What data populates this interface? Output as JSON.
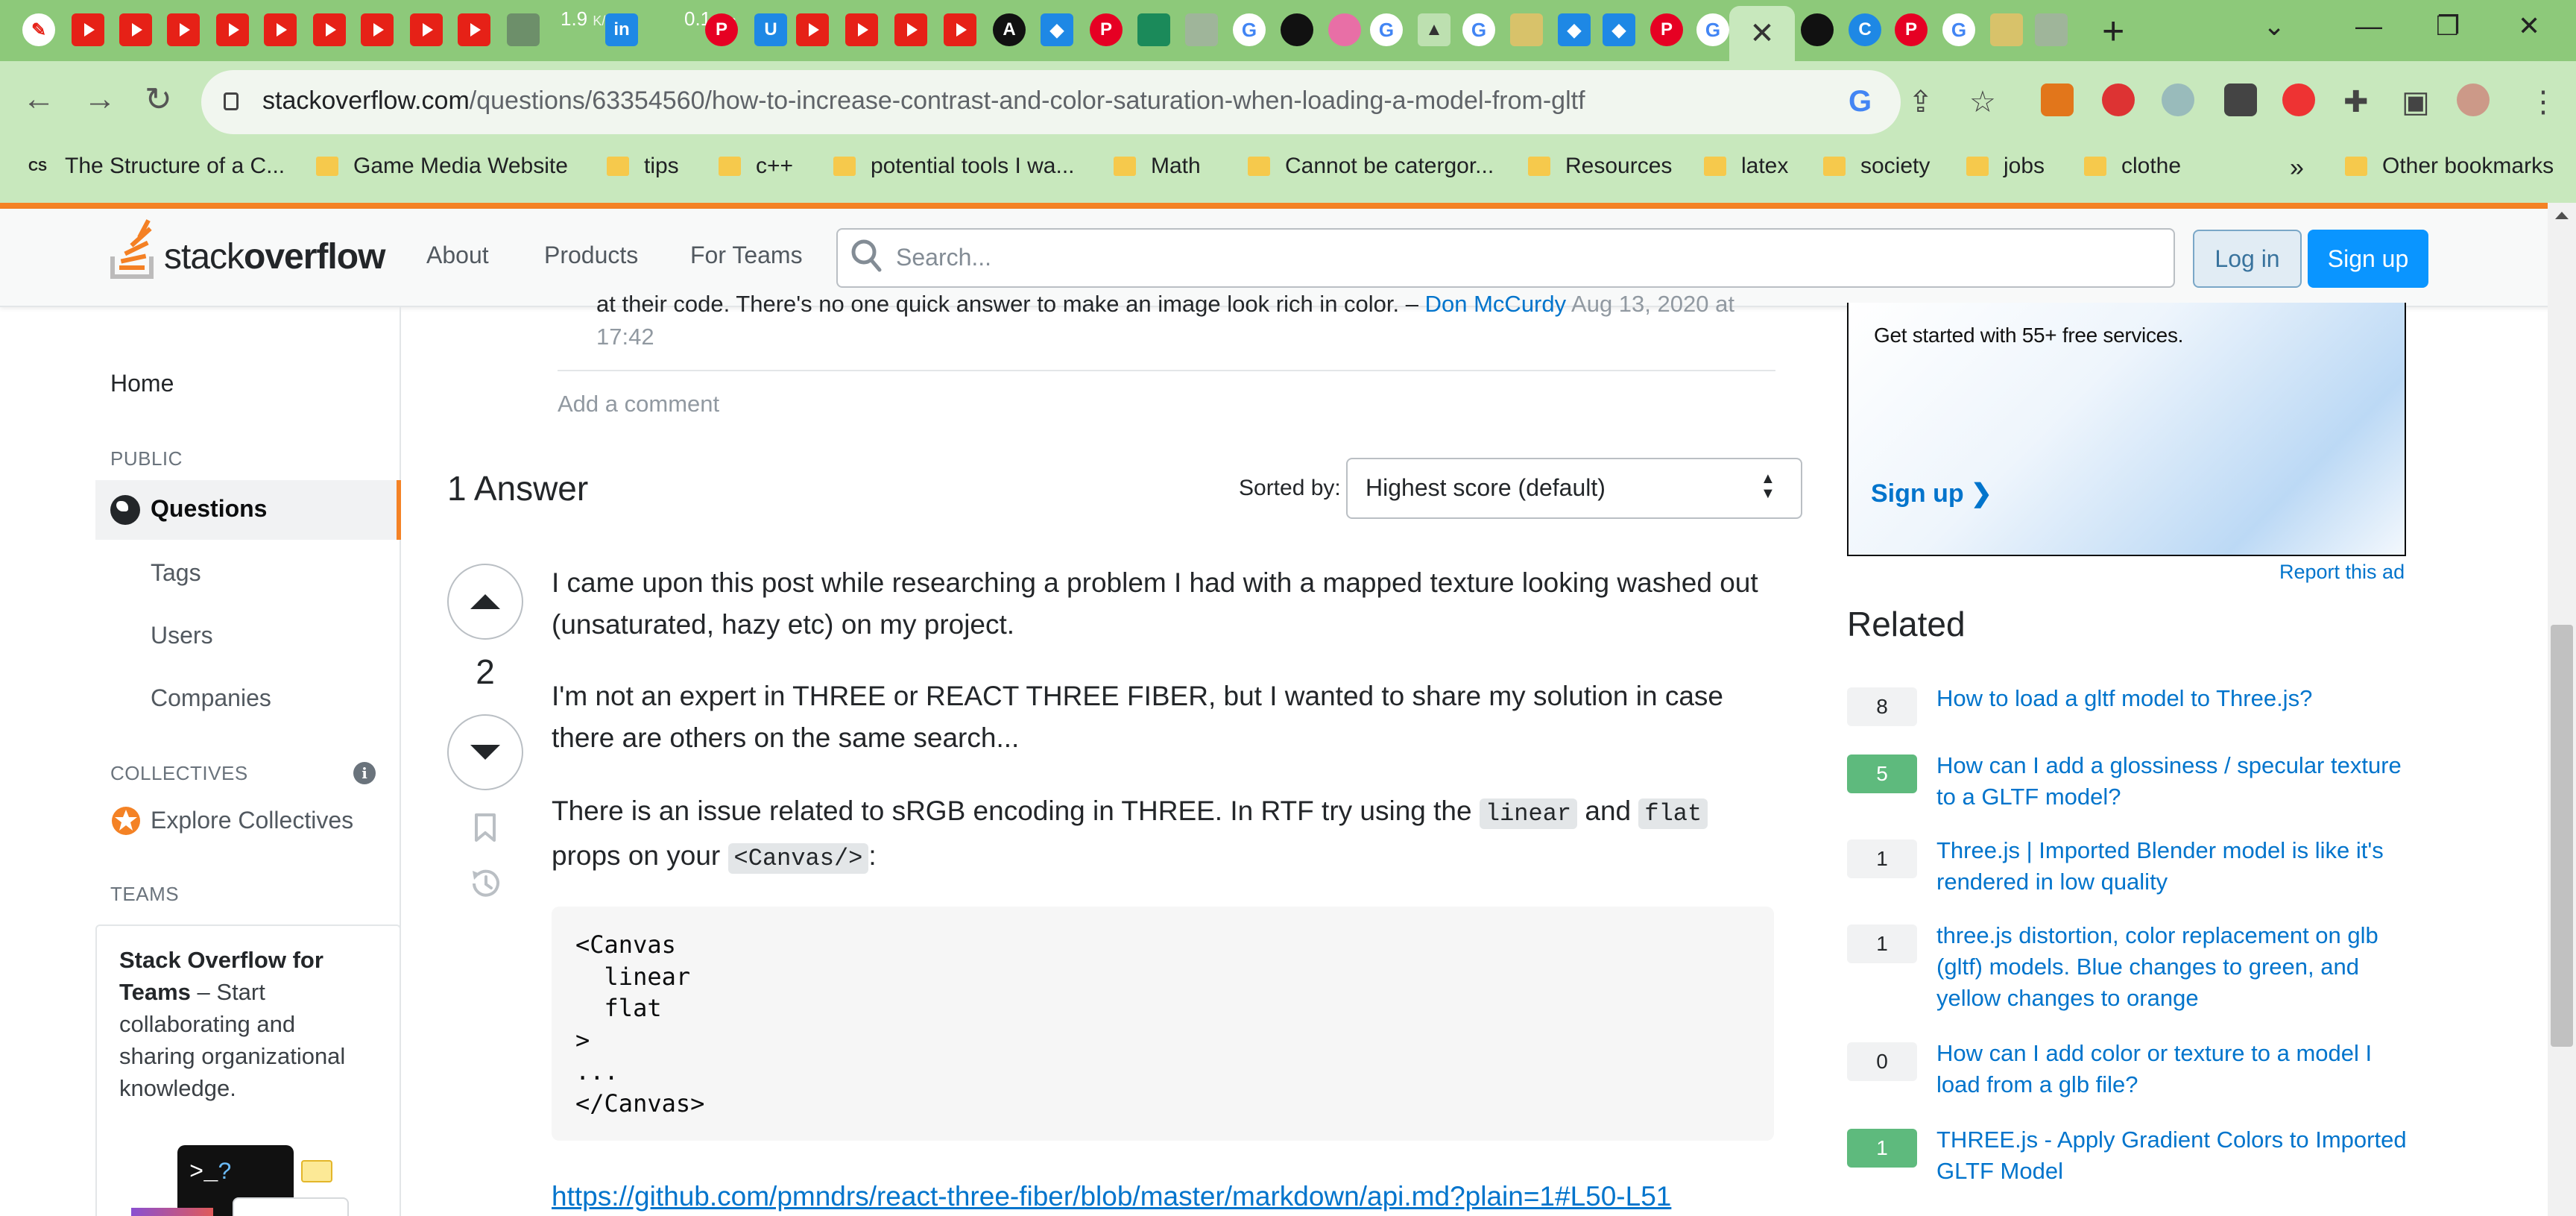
{
  "browser": {
    "active_tab_close": "✕",
    "net_speed_down": "1.9",
    "net_speed_up": "0.1",
    "net_speed_unit": "K/s",
    "url_domain": "stackoverflow.com",
    "url_path": "/questions/63354560/how-to-increase-contrast-and-color-saturation-when-loading-a-model-from-gltf",
    "new_tab": "+",
    "bookmarks": [
      {
        "label": "The Structure of a C..."
      },
      {
        "label": "Game Media Website"
      },
      {
        "label": "tips"
      },
      {
        "label": "c++"
      },
      {
        "label": "potential tools I wa..."
      },
      {
        "label": "Math"
      },
      {
        "label": "Cannot be catergor..."
      },
      {
        "label": "Resources"
      },
      {
        "label": "latex"
      },
      {
        "label": "society"
      },
      {
        "label": "jobs"
      },
      {
        "label": "clothe"
      }
    ],
    "bookmarks_more": "»",
    "other_bookmarks": "Other bookmarks",
    "cs_favicon": "CS"
  },
  "so_header": {
    "logo_light": "stack",
    "logo_bold": "overflow",
    "nav": [
      "About",
      "Products",
      "For Teams"
    ],
    "search_placeholder": "Search...",
    "login_label": "Log in",
    "signup_label": "Sign up"
  },
  "left_sidebar": {
    "home": "Home",
    "public_heading": "PUBLIC",
    "questions": "Questions",
    "tags": "Tags",
    "users": "Users",
    "companies": "Companies",
    "collectives_heading": "COLLECTIVES",
    "explore_collectives": "Explore Collectives",
    "teams_heading": "TEAMS",
    "teams_title": "Stack Overflow for Teams",
    "teams_body": " – Start collaborating and sharing organizational knowledge.",
    "teams_prompt": ">_",
    "teams_prompt_q": "?"
  },
  "comment": {
    "text": "at their code. There's no one quick answer to make an image look rich in color. –",
    "user": "Don McCurdy",
    "date": "Aug 13, 2020 at 17:42",
    "add_comment": "Add a comment"
  },
  "answers": {
    "heading": "1 Answer",
    "sorted_by_label": "Sorted by:",
    "sort_value": "Highest score (default)",
    "vote_count": "2",
    "p1": "I came upon this post while researching a problem I had with a mapped texture looking washed out (unsaturated, hazy etc) on my project.",
    "p2": "I'm not an expert in THREE or REACT THREE FIBER, but I wanted to share my solution in case there are others on the same search...",
    "p3_before": "There is an issue related to sRGB encoding in THREE. In RTF try using the ",
    "p3_code1": "linear",
    "p3_mid": " and ",
    "p3_code2": "flat",
    "p3_after": " props on your ",
    "p3_code3": "<Canvas/>",
    "p3_end": ":",
    "code": "<Canvas\n  linear\n  flat\n>\n...\n</Canvas>",
    "link": "https://github.com/pmndrs/react-three-fiber/blob/master/markdown/api.md?plain=1#L50-L51"
  },
  "ad": {
    "text": "Get started with 55+ free services.",
    "signup": "Sign up ❯",
    "report": "Report this ad"
  },
  "related": {
    "heading": "Related",
    "items": [
      {
        "count": "8",
        "answered": false,
        "title": "How to load a gltf model to Three.js?"
      },
      {
        "count": "5",
        "answered": true,
        "title": "How can I add a glossiness / specular texture to a GLTF model?"
      },
      {
        "count": "1",
        "answered": false,
        "title": "Three.js | Imported Blender model is like it's rendered in low quality"
      },
      {
        "count": "1",
        "answered": false,
        "title": "three.js distortion, color replacement on glb (gltf) models. Blue changes to green, and yellow changes to orange"
      },
      {
        "count": "0",
        "answered": false,
        "title": "How can I add color or texture to a model I load from a glb file?"
      },
      {
        "count": "1",
        "answered": true,
        "title": "THREE.js - Apply Gradient Colors to Imported GLTF Model"
      }
    ]
  },
  "colors": {
    "so_orange": "#f48225",
    "so_blue": "#0a95ff",
    "link_blue": "#0074cc",
    "answered_green": "#5eba7d",
    "tabbar_green": "#8dc97a"
  }
}
